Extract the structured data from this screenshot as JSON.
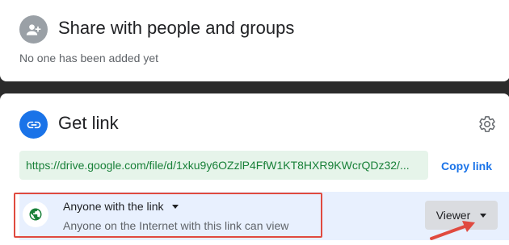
{
  "share": {
    "title": "Share with people and groups",
    "subtext": "No one has been added yet",
    "icon": "add-person-icon"
  },
  "get_link": {
    "title": "Get link",
    "icon": "link-icon",
    "settings_icon": "gear-icon",
    "url": "https://drive.google.com/file/d/1xku9y6OZzlP4FfW1KT8HXR9KWcrQDz32/...",
    "copy_label": "Copy link"
  },
  "access": {
    "icon": "globe-icon",
    "label": "Anyone with the link",
    "description": "Anyone on the Internet with this link can view",
    "role": "Viewer"
  },
  "annotations": {
    "highlight_box": "red-highlight-box",
    "arrow": "red-arrow"
  },
  "colors": {
    "accent": "#1a73e8",
    "url_bg": "#e6f4ea",
    "url_text": "#188038",
    "access_row_bg": "#e8f0fe",
    "annotation_red": "#e04a3f",
    "page_bg": "#2b2b2b"
  }
}
